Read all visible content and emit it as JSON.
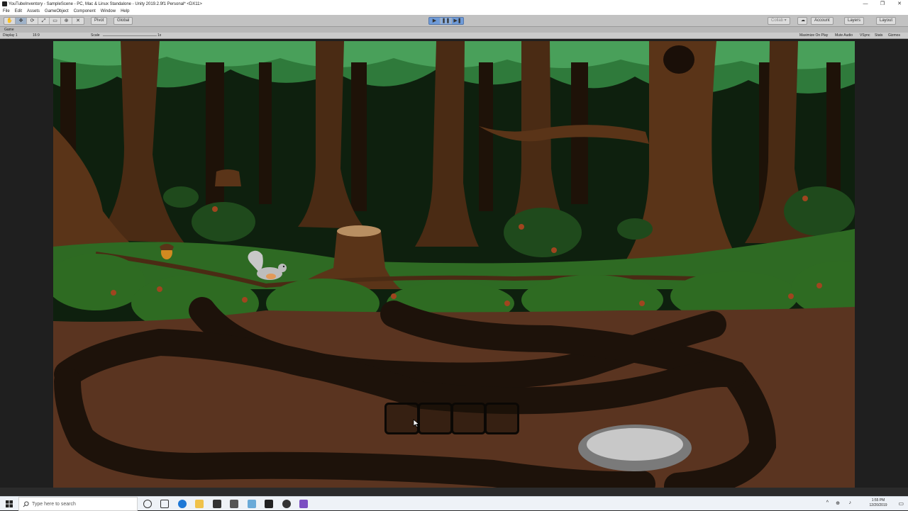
{
  "window": {
    "title": "YouTubeInventory - SampleScene - PC, Mac & Linux Standalone - Unity 2019.2.9f1 Personal* <DX11>",
    "controls": [
      "—",
      "❐",
      "✕"
    ]
  },
  "menu": [
    "File",
    "Edit",
    "Assets",
    "GameObject",
    "Component",
    "Window",
    "Help"
  ],
  "toolbar": {
    "transform_tools": [
      "✋",
      "✥",
      "⟳",
      "⤢",
      "▭",
      "⊕",
      "✕"
    ],
    "pivot_label": "Pivot",
    "global_label": "Global",
    "collab_label": "Collab ▾",
    "account_label": "Account",
    "layers_label": "Layers",
    "layout_label": "Layout"
  },
  "tab": {
    "label": "Game"
  },
  "gamebar": {
    "display": "Display 1",
    "aspect": "16:9",
    "scale_label": "Scale",
    "scale_value": "1x",
    "maximize": "Maximize On Play",
    "mute": "Mute Audio",
    "vsync": "VSync",
    "stats": "Stats",
    "gizmos": "Gizmos"
  },
  "inventory": {
    "slot_count": 4
  },
  "taskbar": {
    "search_placeholder": "Type here to search",
    "time": "1:55 PM",
    "date": "12/20/2019"
  },
  "colors": {
    "titlebar": "#ffffff",
    "toolbar": "#c2c2c2",
    "play_active": "#6f9bd8",
    "sky": "#0f240f",
    "canopy": "#2f7a3b",
    "trunk": "#5a3418",
    "ground": "#5a3420",
    "tunnel": "#1d120a",
    "grass": "#2f6b22"
  }
}
